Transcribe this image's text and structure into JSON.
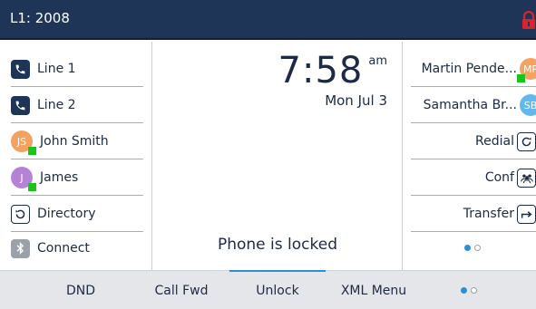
{
  "header": {
    "line_status": "L1: 2008",
    "lock_icon": "lock-icon",
    "lock_color": "#d9232e"
  },
  "left_keys": [
    {
      "label": "Line 1",
      "icon": "phone-icon"
    },
    {
      "label": "Line 2",
      "icon": "phone-icon"
    },
    {
      "label": "John Smith",
      "avatar": "JS",
      "avatar_color": "#f4a262"
    },
    {
      "label": "James",
      "avatar": "J",
      "avatar_color": "#b583d6"
    },
    {
      "label": "Directory",
      "icon": "directory-icon"
    },
    {
      "label": "Connect",
      "icon": "bluetooth-icon"
    }
  ],
  "clock": {
    "time": "7:58",
    "ampm": "am",
    "date": "Mon Jul 3"
  },
  "status": {
    "message": "Phone is locked"
  },
  "right_keys": [
    {
      "label": "Martin Pende...",
      "avatar": "MP",
      "avatar_color": "#f4a262"
    },
    {
      "label": "Samantha Br...",
      "avatar": "SB",
      "avatar_color": "#62b8ec"
    },
    {
      "label": "Redial",
      "icon": "redial-icon"
    },
    {
      "label": "Conf",
      "icon": "conference-icon"
    },
    {
      "label": "Transfer",
      "icon": "transfer-icon"
    }
  ],
  "softkeys": [
    {
      "label": "DND"
    },
    {
      "label": "Call Fwd"
    },
    {
      "label": "Unlock",
      "active": true
    },
    {
      "label": "XML Menu"
    }
  ],
  "colors": {
    "header_bg": "#1e3558",
    "accent": "#2a8fd6",
    "presence": "#19c51a"
  }
}
